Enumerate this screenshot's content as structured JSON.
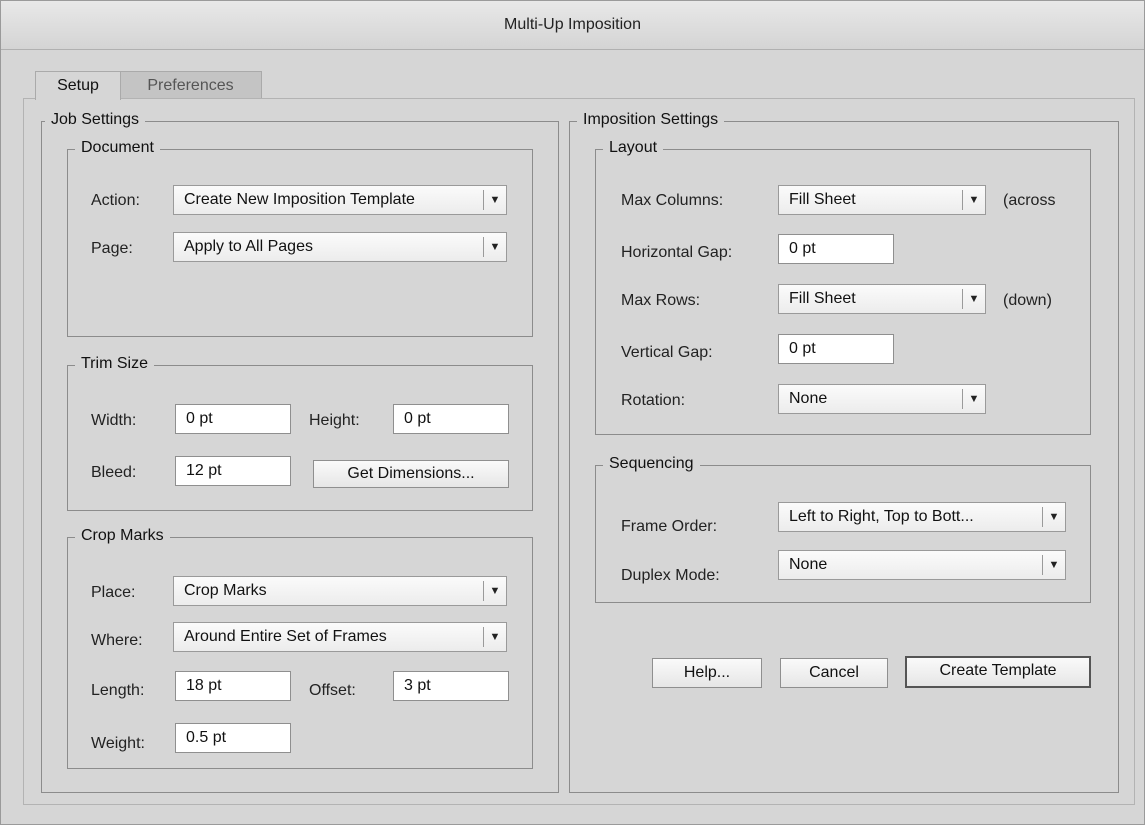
{
  "window": {
    "title": "Multi-Up Imposition"
  },
  "tabs": [
    {
      "label": "Setup",
      "active": true
    },
    {
      "label": "Preferences",
      "active": false
    }
  ],
  "job_settings": {
    "title": "Job Settings",
    "document": {
      "title": "Document",
      "action_label": "Action:",
      "action_value": "Create New Imposition Template",
      "page_label": "Page:",
      "page_value": "Apply to All Pages"
    },
    "trim_size": {
      "title": "Trim Size",
      "width_label": "Width:",
      "width_value": "0 pt",
      "height_label": "Height:",
      "height_value": "0 pt",
      "bleed_label": "Bleed:",
      "bleed_value": "12 pt",
      "get_dimensions_label": "Get Dimensions..."
    },
    "crop_marks": {
      "title": "Crop Marks",
      "place_label": "Place:",
      "place_value": "Crop Marks",
      "where_label": "Where:",
      "where_value": "Around Entire Set of Frames",
      "length_label": "Length:",
      "length_value": "18 pt",
      "offset_label": "Offset:",
      "offset_value": "3 pt",
      "weight_label": "Weight:",
      "weight_value": "0.5 pt"
    }
  },
  "imposition_settings": {
    "title": "Imposition Settings",
    "layout": {
      "title": "Layout",
      "max_columns_label": "Max Columns:",
      "max_columns_value": "Fill Sheet",
      "max_columns_hint": "(across",
      "horizontal_gap_label": "Horizontal Gap:",
      "horizontal_gap_value": "0 pt",
      "max_rows_label": "Max Rows:",
      "max_rows_value": "Fill Sheet",
      "max_rows_hint": "(down)",
      "vertical_gap_label": "Vertical Gap:",
      "vertical_gap_value": "0 pt",
      "rotation_label": "Rotation:",
      "rotation_value": "None"
    },
    "sequencing": {
      "title": "Sequencing",
      "frame_order_label": "Frame Order:",
      "frame_order_value": "Left to Right, Top to Bott...",
      "duplex_mode_label": "Duplex Mode:",
      "duplex_mode_value": "None"
    }
  },
  "buttons": {
    "help": "Help...",
    "cancel": "Cancel",
    "create_template": "Create Template"
  },
  "icons": {
    "dropdown": "chevron-down-icon",
    "caret_glyph": "▼"
  }
}
